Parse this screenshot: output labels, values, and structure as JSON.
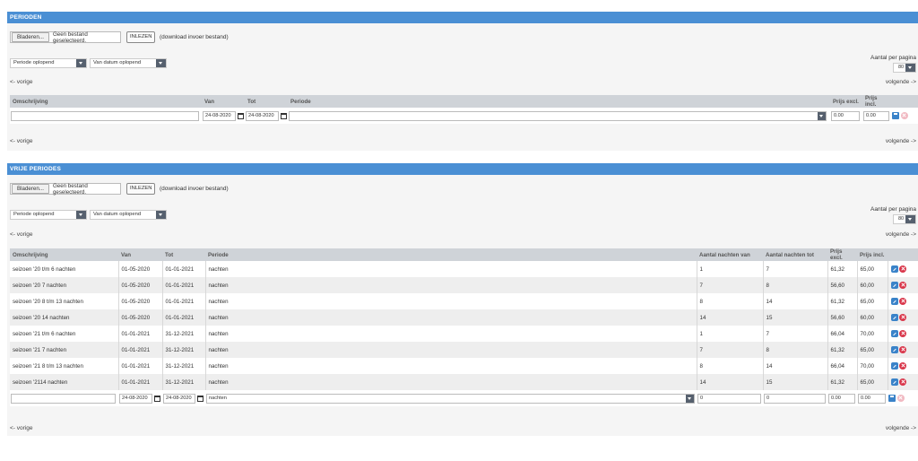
{
  "colors": {
    "header": "#4a8fd4",
    "edit": "#3a83c9",
    "delete": "#d9364a",
    "select_arrow": "#56606e",
    "table_head": "#cfd3d8"
  },
  "perioden": {
    "title": "PERIODEN",
    "browse_label": "Bladeren...",
    "file_status": "Geen bestand geselecteerd.",
    "inlezen_label": "INLEZEN",
    "download_label": "(download invoer bestand)",
    "sort_select": "Periode oplopend",
    "sort_select2": "Van datum oplopend",
    "per_page_label": "Aantal per pagina",
    "per_page_value": "80",
    "prev_label": "<- vorige",
    "next_label": "volgende ->",
    "columns": [
      "Omschrijving",
      "Van",
      "Tot",
      "Periode",
      "Prijs excl.",
      "Prijs incl."
    ],
    "new_row": {
      "omschrijving": "",
      "van": "24-08-2020",
      "tot": "24-08-2020",
      "periode": "",
      "prijs_excl": "0.00",
      "prijs_incl": "0.00"
    },
    "icons": [
      "calendar-icon",
      "save-icon",
      "delete-icon"
    ]
  },
  "vrije_perioden": {
    "title": "VRIJE PERIODES",
    "browse_label": "Bladeren...",
    "file_status": "Geen bestand geselecteerd.",
    "inlezen_label": "INLEZEN",
    "download_label": "(download invoer bestand)",
    "sort_select": "Periode oplopend",
    "sort_select2": "Van datum oplopend",
    "per_page_label": "Aantal per pagina",
    "per_page_value": "80",
    "prev_label": "<- vorige",
    "next_label": "volgende ->",
    "columns": [
      "Omschrijving",
      "Van",
      "Tot",
      "Periode",
      "Aantal nachten van",
      "Aantal nachten tot",
      "Prijs excl.",
      "Prijs incl."
    ],
    "rows": [
      {
        "omschrijving": "seizoen '20 t/m 6 nachten",
        "van": "01-05-2020",
        "tot": "01-01-2021",
        "periode": "nachten",
        "nachten_van": "1",
        "nachten_tot": "7",
        "prijs_excl": "61,32",
        "prijs_incl": "65,00"
      },
      {
        "omschrijving": "seizoen '20 7 nachten",
        "van": "01-05-2020",
        "tot": "01-01-2021",
        "periode": "nachten",
        "nachten_van": "7",
        "nachten_tot": "8",
        "prijs_excl": "56,60",
        "prijs_incl": "60,00"
      },
      {
        "omschrijving": "seizoen '20 8 t/m 13 nachten",
        "van": "01-05-2020",
        "tot": "01-01-2021",
        "periode": "nachten",
        "nachten_van": "8",
        "nachten_tot": "14",
        "prijs_excl": "61,32",
        "prijs_incl": "65,00"
      },
      {
        "omschrijving": "seizoen '20 14 nachten",
        "van": "01-05-2020",
        "tot": "01-01-2021",
        "periode": "nachten",
        "nachten_van": "14",
        "nachten_tot": "15",
        "prijs_excl": "56,60",
        "prijs_incl": "60,00"
      },
      {
        "omschrijving": "seizoen '21 t/m 6 nachten",
        "van": "01-01-2021",
        "tot": "31-12-2021",
        "periode": "nachten",
        "nachten_van": "1",
        "nachten_tot": "7",
        "prijs_excl": "66,04",
        "prijs_incl": "70,00"
      },
      {
        "omschrijving": "seizoen '21 7 nachten",
        "van": "01-01-2021",
        "tot": "31-12-2021",
        "periode": "nachten",
        "nachten_van": "7",
        "nachten_tot": "8",
        "prijs_excl": "61,32",
        "prijs_incl": "65,00"
      },
      {
        "omschrijving": "seizoen '21 8 t/m 13 nachten",
        "van": "01-01-2021",
        "tot": "31-12-2021",
        "periode": "nachten",
        "nachten_van": "8",
        "nachten_tot": "14",
        "prijs_excl": "66,04",
        "prijs_incl": "70,00"
      },
      {
        "omschrijving": "seizoen '2114 nachten",
        "van": "01-01-2021",
        "tot": "31-12-2021",
        "periode": "nachten",
        "nachten_van": "14",
        "nachten_tot": "15",
        "prijs_excl": "61,32",
        "prijs_incl": "65,00"
      }
    ],
    "new_row": {
      "omschrijving": "",
      "van": "24-08-2020",
      "tot": "24-08-2020",
      "periode": "nachten",
      "nachten_van": "0",
      "nachten_tot": "0",
      "prijs_excl": "0.00",
      "prijs_incl": "0.00"
    },
    "icons": [
      "edit-icon",
      "delete-icon",
      "calendar-icon",
      "save-icon"
    ]
  }
}
